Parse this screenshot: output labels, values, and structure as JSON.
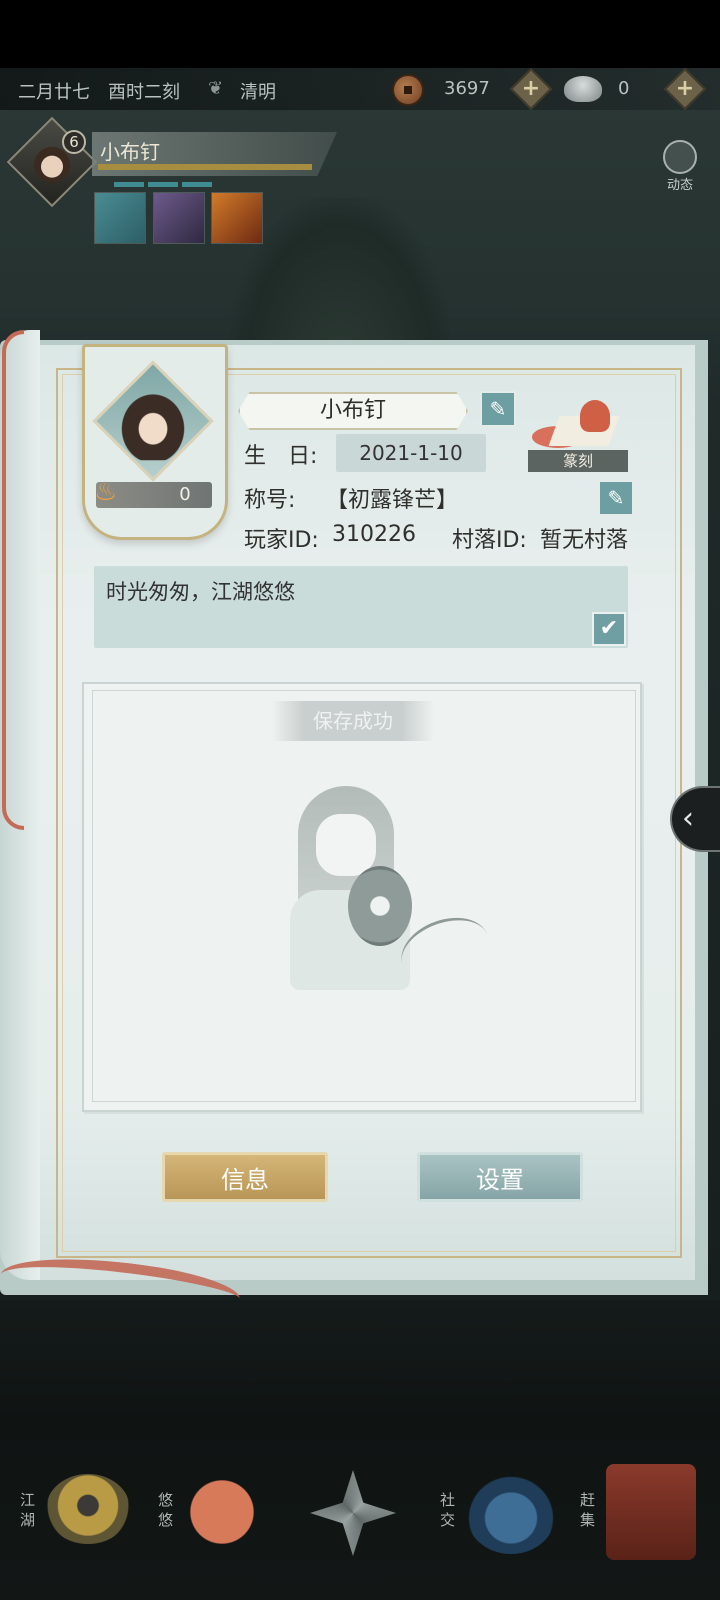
{
  "topbar": {
    "date": "二月廿七",
    "time": "酉时二刻",
    "solar_term": "清明",
    "copper_count": "3697",
    "silver_count": "0",
    "plus": "+"
  },
  "character": {
    "level": "6",
    "name": "小布钉",
    "dynamics_label": "动态"
  },
  "profile": {
    "name": "小布钉",
    "birthday_label": "生　日:",
    "birthday_value": "2021-1-10",
    "title_label": "称号:",
    "title_value": "【初露锋芒】",
    "player_id_label": "玩家ID:",
    "player_id_value": "310226",
    "village_id_label": "村落ID:",
    "village_id_value": "暂无村落",
    "fire_value": "0",
    "stamp_label": "篆刻",
    "signature": "时光匆匆，江湖悠悠",
    "toast": "保存成功"
  },
  "buttons": {
    "info": "信息",
    "settings": "设置"
  },
  "side_tab": "‹",
  "bottom_nav": [
    {
      "label": "江湖"
    },
    {
      "label": "悠悠"
    },
    {
      "label": ""
    },
    {
      "label": "社交"
    },
    {
      "label": "赶集"
    }
  ],
  "colors": {
    "accent_gold": "#c4b37e",
    "teal": "#6d9ea1",
    "ribbon": "#c46a56"
  }
}
